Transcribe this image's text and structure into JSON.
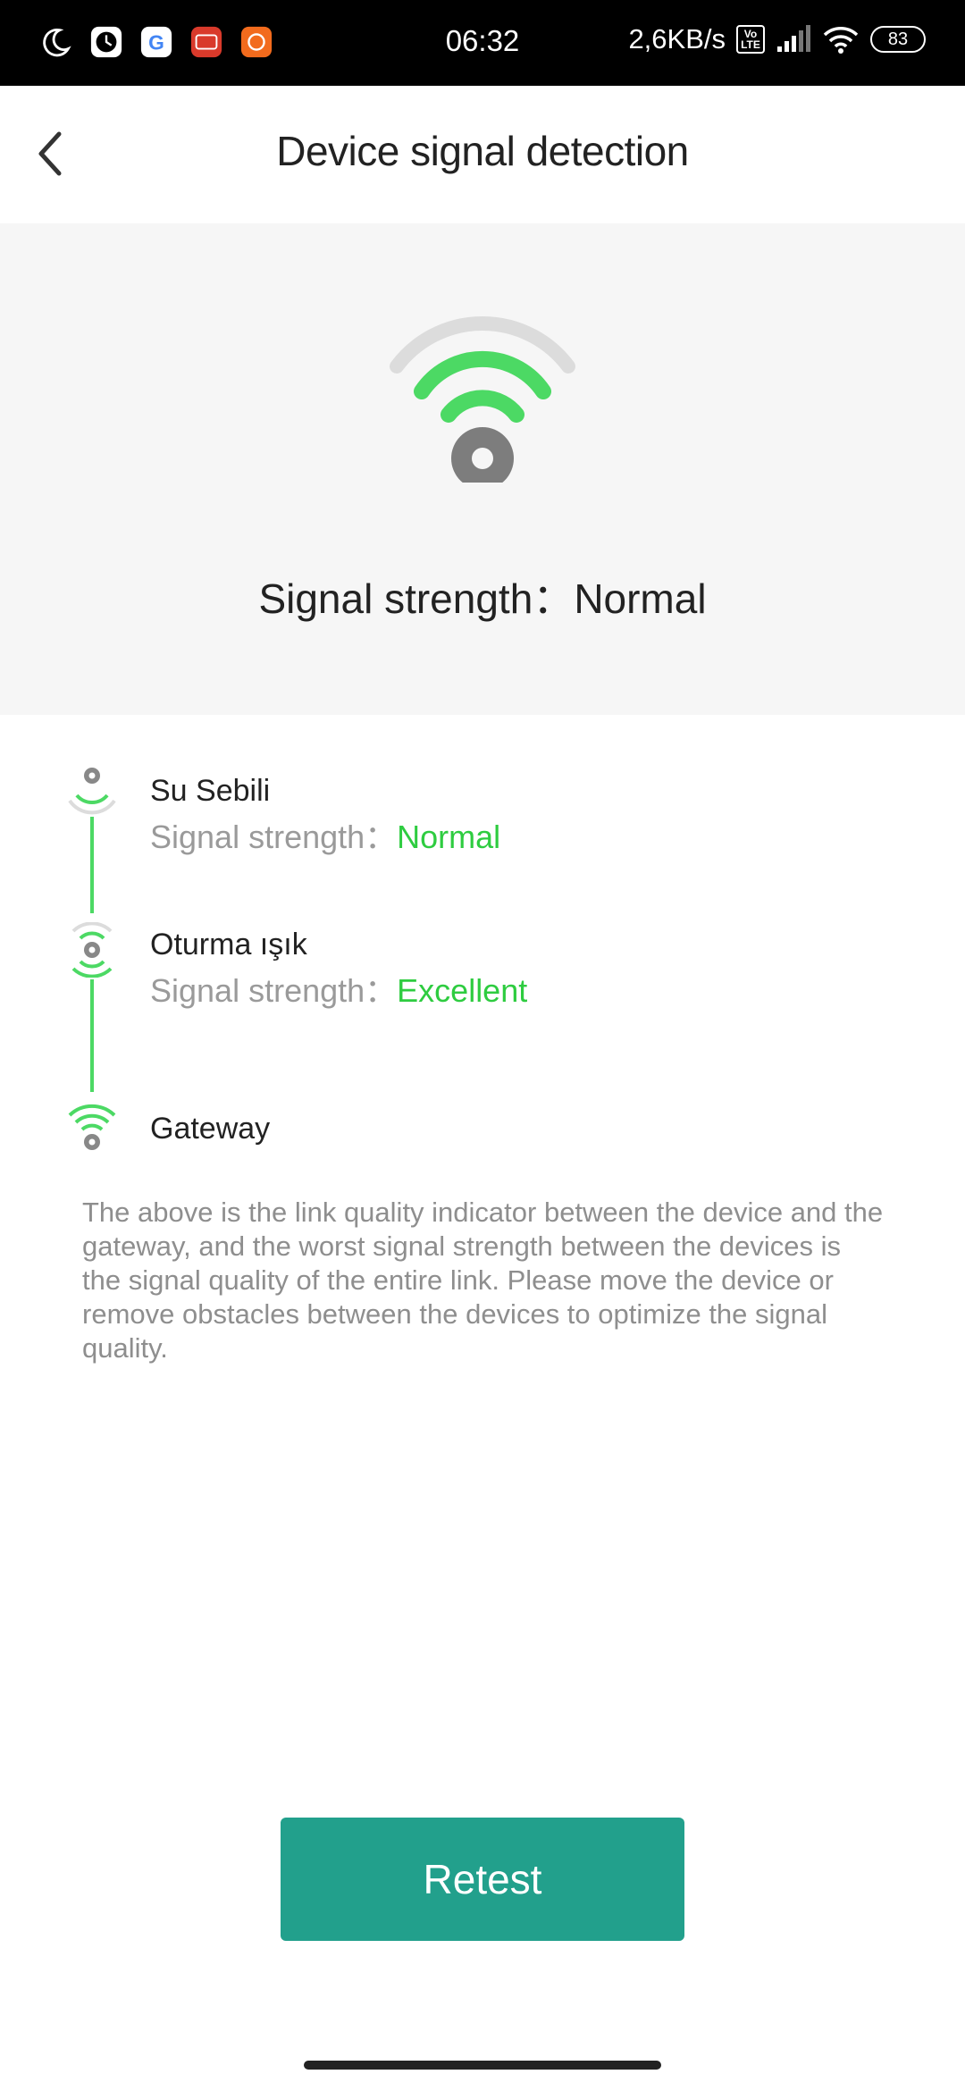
{
  "statusbar": {
    "time": "06:32",
    "net_speed": "2,6KB/s",
    "volte": "Vo LTE",
    "battery": "83",
    "icons": [
      "moon-icon",
      "clock-icon",
      "google-icon",
      "app-icon",
      "mi-icon",
      "signal-bars-icon",
      "wifi-icon",
      "battery-icon"
    ]
  },
  "header": {
    "title": "Device signal detection",
    "back_icon": "chevron-left-icon"
  },
  "hero": {
    "label": "Signal strength：",
    "value": "Normal",
    "icon": "wifi-signal-icon"
  },
  "chain": {
    "nodes": [
      {
        "name": "Su Sebili",
        "label": "Signal strength：",
        "value": "Normal"
      },
      {
        "name": "Oturma ışık",
        "label": "Signal strength：",
        "value": "Excellent"
      },
      {
        "name": "Gateway"
      }
    ]
  },
  "note": "The above is the link quality indicator between the device and the gateway, and the worst signal strength between the devices is the signal quality of the entire link. Please move the device or remove obstacles between the devices to optimize the signal quality.",
  "actions": {
    "retest": "Retest"
  },
  "colors": {
    "accent": "#22a08c",
    "signal_green": "#2ecc40",
    "arc_green": "#4cd964"
  }
}
